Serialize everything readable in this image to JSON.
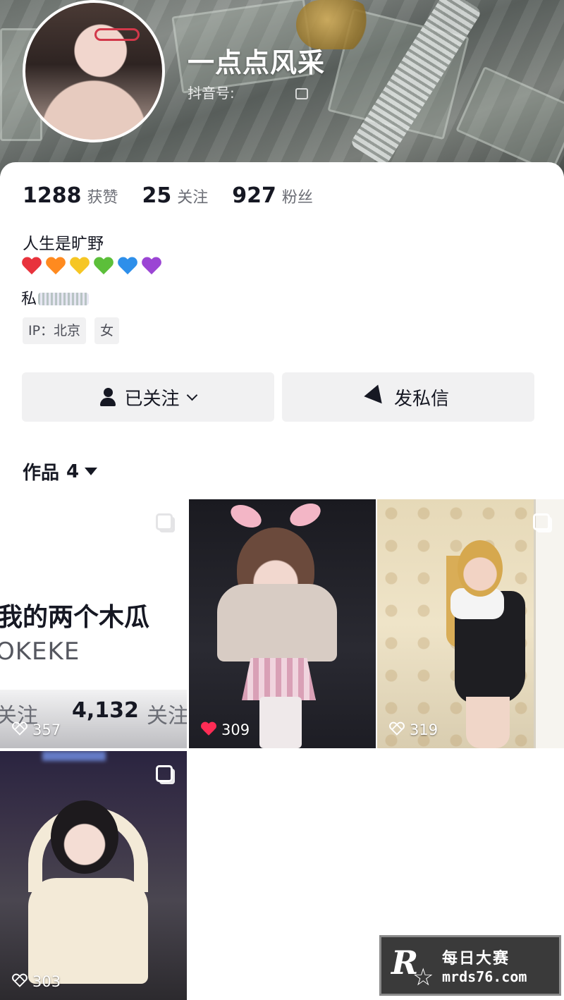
{
  "profile": {
    "nickname": "一点点风采",
    "douyin_id_label": "抖音号:"
  },
  "stats": [
    {
      "value": "1288",
      "label": "获赞"
    },
    {
      "value": "25",
      "label": "关注"
    },
    {
      "value": "927",
      "label": "粉丝"
    }
  ],
  "bio": {
    "line1": "人生是旷野",
    "hearts": [
      "#e8323c",
      "#ff8a1f",
      "#f6c624",
      "#5cbf3a",
      "#2e8fea",
      "#9b45d4"
    ],
    "line3_prefix": "私"
  },
  "tags": [
    "IP：北京",
    "女"
  ],
  "actions": {
    "follow_label": "已关注",
    "message_label": "发私信"
  },
  "works": {
    "label": "作品",
    "count": "4"
  },
  "posts": [
    {
      "likes": "357",
      "liked": false,
      "preview_title": "我的两个木瓜",
      "preview_brand": "OKEKE",
      "preview_stat_a": "关注",
      "preview_stat_b": "4,132",
      "preview_stat_c": "关注"
    },
    {
      "likes": "309",
      "liked": true
    },
    {
      "likes": "319",
      "liked": false
    },
    {
      "likes": "303",
      "liked": false
    }
  ],
  "watermark": {
    "logo_letter": "R",
    "cn": "每日大赛",
    "url": "mrds76.com"
  },
  "colors": {
    "like_red": "#fe2c55",
    "button_bg": "#f1f1f2",
    "text_primary": "#161823"
  },
  "icons": [
    "copy-icon",
    "person-check-icon",
    "chevron-down-icon",
    "send-icon",
    "caret-down-icon",
    "multi-image-icon",
    "heart-icon"
  ]
}
